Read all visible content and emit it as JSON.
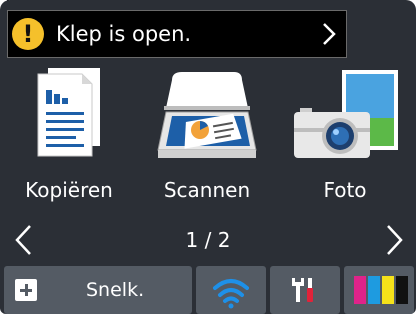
{
  "alert": {
    "text": "Klep is open.",
    "icon": "exclamation-icon",
    "icon_glyph": "!",
    "color": "#f5c02b"
  },
  "apps": [
    {
      "label": "Kopiëren",
      "icon": "copy-icon"
    },
    {
      "label": "Scannen",
      "icon": "scan-icon"
    },
    {
      "label": "Foto",
      "icon": "photo-icon"
    }
  ],
  "pager": {
    "text": "1 / 2"
  },
  "bottom": {
    "shortcut_label": "Snelk.",
    "icons": [
      "plus-icon",
      "wifi-icon",
      "tools-icon",
      "ink-icon"
    ],
    "ink_colors": [
      "#e0238a",
      "#1e9be0",
      "#f6e21a",
      "#111111"
    ],
    "wifi_color": "#1e90e8"
  },
  "colors": {
    "screen_bg": "#2b2f36",
    "button_bg": "#545b64"
  }
}
